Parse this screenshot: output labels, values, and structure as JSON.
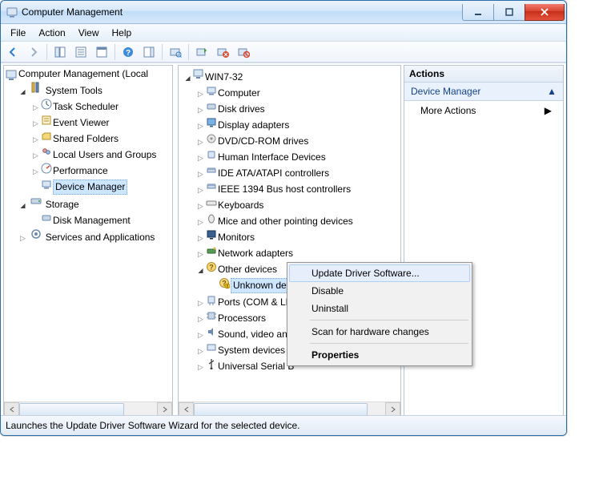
{
  "window": {
    "title": "Computer Management"
  },
  "menubar": {
    "items": [
      "File",
      "Action",
      "View",
      "Help"
    ]
  },
  "left_tree": {
    "root": "Computer Management (Local",
    "groups": [
      {
        "label": "System Tools",
        "children": [
          "Task Scheduler",
          "Event Viewer",
          "Shared Folders",
          "Local Users and Groups",
          "Performance",
          "Device Manager"
        ],
        "selected_index": 5
      },
      {
        "label": "Storage",
        "children": [
          "Disk Management"
        ]
      },
      {
        "label": "Services and Applications",
        "children": []
      }
    ]
  },
  "device_tree": {
    "root": "WIN7-32",
    "items": [
      "Computer",
      "Disk drives",
      "Display adapters",
      "DVD/CD-ROM drives",
      "Human Interface Devices",
      "IDE ATA/ATAPI controllers",
      "IEEE 1394 Bus host controllers",
      "Keyboards",
      "Mice and other pointing devices",
      "Monitors",
      "Network adapters"
    ],
    "other": {
      "label": "Other devices",
      "child": "Unknown device"
    },
    "after": [
      "Ports (COM & LP",
      "Processors",
      "Sound, video and",
      "System devices",
      "Universal Serial B"
    ]
  },
  "actions_pane": {
    "header": "Actions",
    "group": "Device Manager",
    "item": "More Actions"
  },
  "context_menu": {
    "items": [
      "Update Driver Software...",
      "Disable",
      "Uninstall",
      "Scan for hardware changes",
      "Properties"
    ],
    "hover_index": 0,
    "bold_index": 4,
    "separators_after": [
      2,
      3
    ]
  },
  "statusbar": {
    "text": "Launches the Update Driver Software Wizard for the selected device."
  }
}
